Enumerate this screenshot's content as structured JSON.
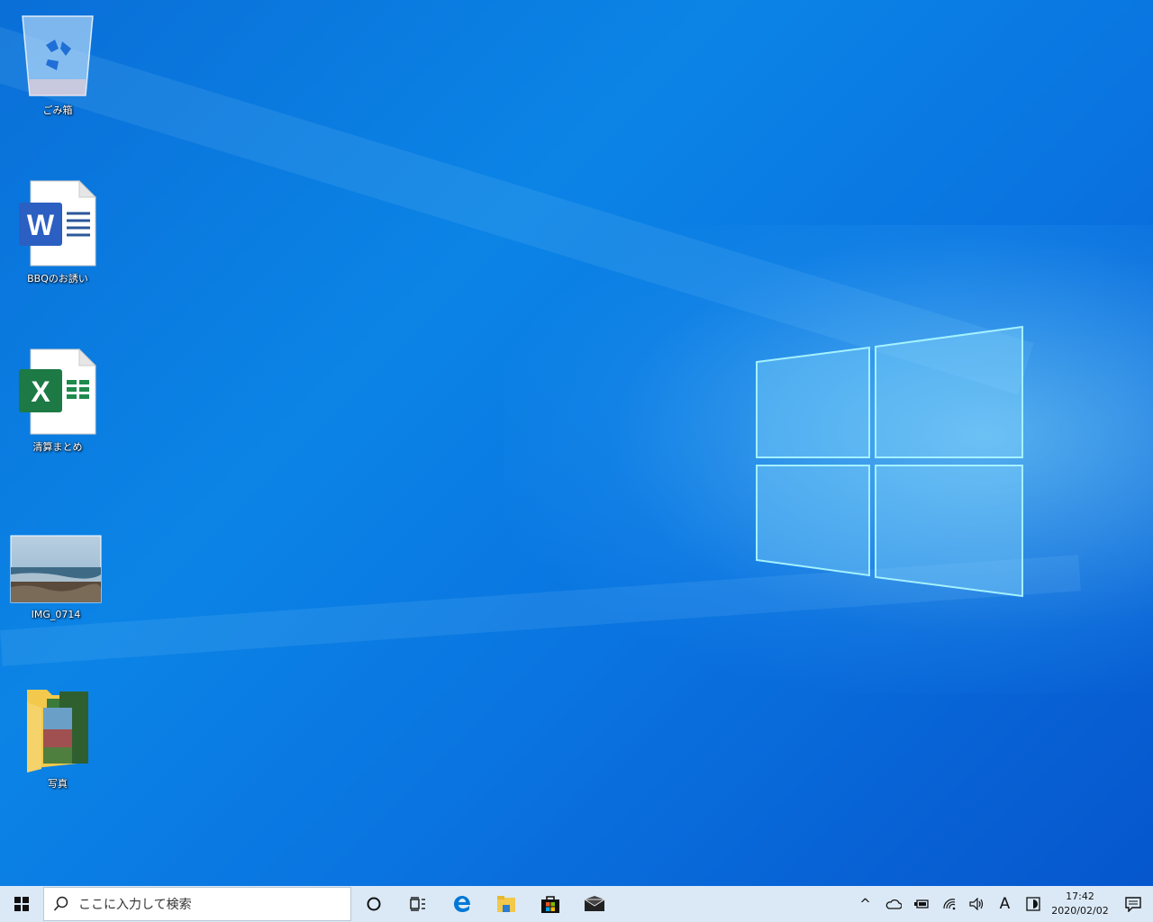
{
  "desktop": {
    "icons": [
      {
        "label": "ごみ箱",
        "icon": "recycle-bin-icon"
      },
      {
        "label": "BBQのお誘い",
        "icon": "word-document-icon"
      },
      {
        "label": "清算まとめ",
        "icon": "excel-spreadsheet-icon"
      },
      {
        "label": "IMG_0714",
        "icon": "photo-thumbnail-icon"
      },
      {
        "label": "写真",
        "icon": "photos-folder-icon"
      }
    ]
  },
  "taskbar": {
    "start_icon": "windows-start-icon",
    "search_placeholder": "ここに入力して検索",
    "pinned": [
      "cortana-icon",
      "task-view-icon",
      "edge-icon",
      "file-explorer-icon",
      "store-icon",
      "mail-icon"
    ],
    "tray": {
      "chevron": "^",
      "ime_label": "A",
      "time": "17:42",
      "date": "2020/02/02"
    }
  },
  "colors": {
    "taskbar": "#dbe9f6",
    "accent": "#0078d7"
  }
}
